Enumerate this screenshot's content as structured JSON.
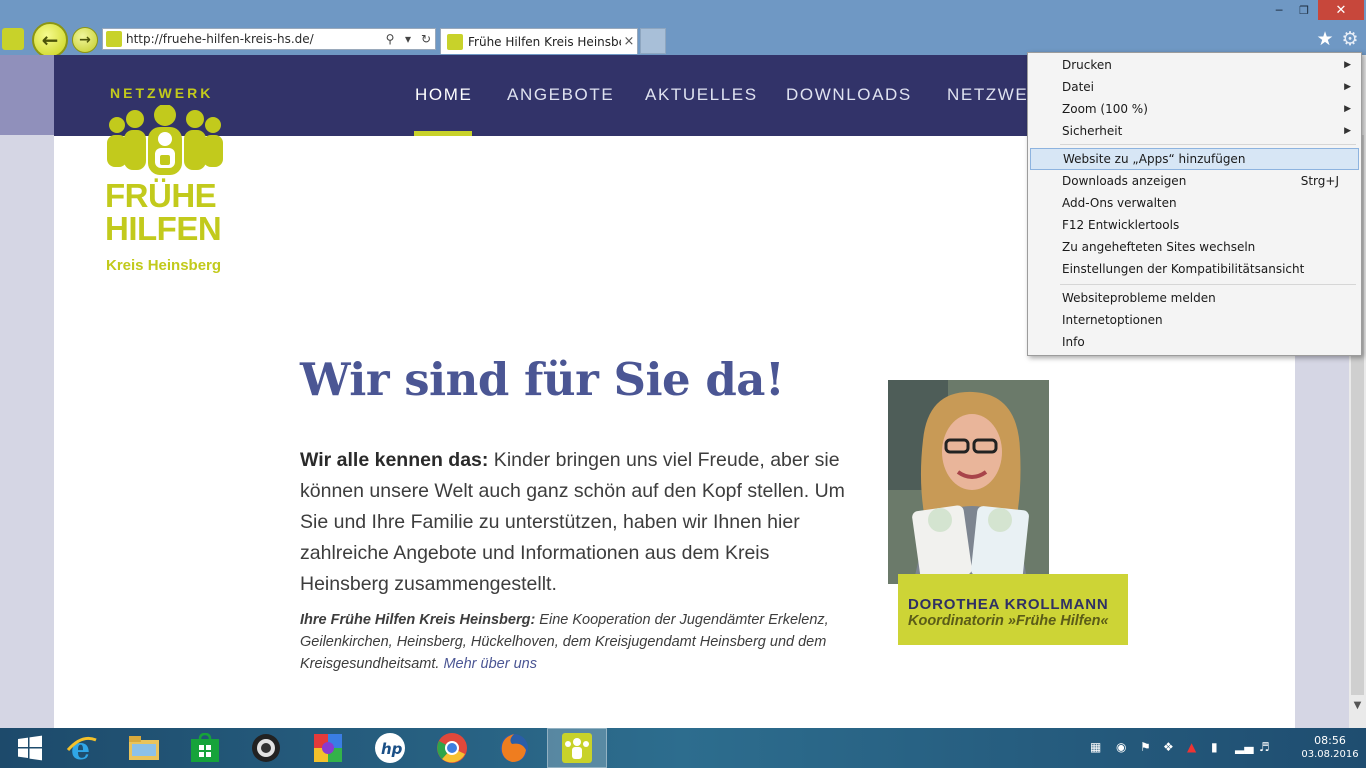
{
  "browser": {
    "address_url": "http://fruehe-hilfen-kreis-hs.de/",
    "tab_title": "Frühe Hilfen Kreis Heinsber...",
    "close_symbol": "×"
  },
  "nav": {
    "items": [
      "HOME",
      "ANGEBOTE",
      "AKTUELLES",
      "DOWNLOADS",
      "NETZWE"
    ],
    "active": "HOME"
  },
  "logo": {
    "top": "NETZWERK",
    "main": "FRÜHE HILFEN",
    "sub": "Kreis Heinsberg"
  },
  "content": {
    "headline": "Wir sind für Sie da!",
    "lead_bold": "Wir alle kennen das:",
    "lead_text": " Kinder bringen uns viel Freude, aber sie können unsere Welt auch ganz schön auf den Kopf stellen. Um Sie und Ihre Familie zu unterstützen, haben wir Ihnen hier zahlreiche Angebote und Informationen aus dem Kreis Heinsberg zusammengestellt.",
    "note_bold": "Ihre Frühe Hilfen Kreis Heinsberg:",
    "note_text": " Eine Kooperation der Jugendämter Erkelenz, Geilenkirchen, Heinsberg, Hückelhoven, dem Kreisjugendamt Heinsberg und dem Kreisgesundheitsamt. ",
    "note_link": "Mehr über uns"
  },
  "person": {
    "name": "DOROTHEA KROLLMANN",
    "role": "Koordinatorin »Frühe Hilfen«"
  },
  "tools_menu": {
    "items": [
      {
        "label": "Drucken",
        "submenu": true
      },
      {
        "label": "Datei",
        "submenu": true
      },
      {
        "label": "Zoom (100 %)",
        "submenu": true
      },
      {
        "label": "Sicherheit",
        "submenu": true
      },
      {
        "label": "Website zu „Apps“ hinzufügen",
        "highlighted": true
      },
      {
        "label": "Downloads anzeigen",
        "shortcut": "Strg+J"
      },
      {
        "label": "Add-Ons verwalten"
      },
      {
        "label": "F12 Entwicklertools"
      },
      {
        "label": "Zu angehefteten Sites wechseln"
      },
      {
        "label": "Einstellungen der Kompatibilitätsansicht"
      },
      {
        "label": "Websiteprobleme melden"
      },
      {
        "label": "Internetoptionen"
      },
      {
        "label": "Info"
      }
    ]
  },
  "taskbar": {
    "apps": [
      "start-icon",
      "internet-explorer-icon",
      "file-explorer-icon",
      "store-icon",
      "webcam-icon",
      "paint-app-icon",
      "hp-icon",
      "chrome-icon",
      "firefox-icon",
      "fruehe-hilfen-site-icon"
    ],
    "time": "08:56",
    "date": "03.08.2016"
  },
  "colors": {
    "nav_bg": "#323369",
    "accent_lime": "#c8d22a",
    "headline": "#4b5694",
    "caption_bg": "#cdd436"
  }
}
